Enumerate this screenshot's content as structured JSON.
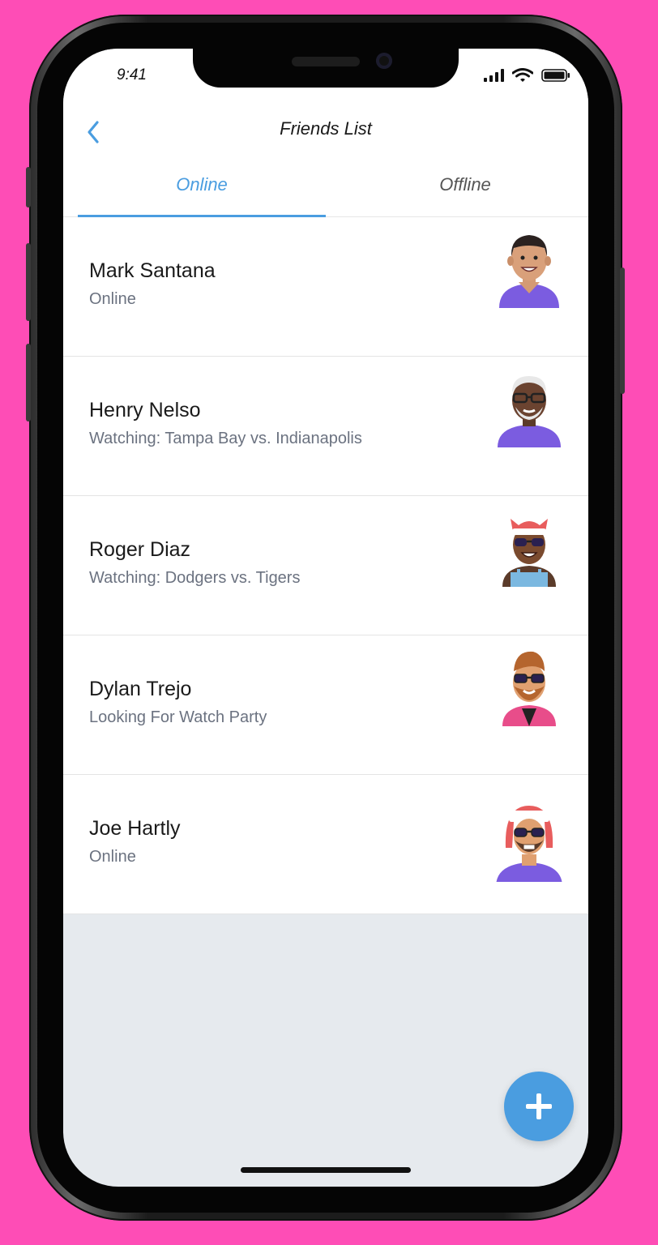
{
  "status_bar": {
    "time": "9:41"
  },
  "nav": {
    "title": "Friends List",
    "back_icon": "chevron-left-icon"
  },
  "tabs": [
    {
      "label": "Online",
      "active": true
    },
    {
      "label": "Offline",
      "active": false
    }
  ],
  "friends": [
    {
      "name": "Mark Santana",
      "status": "Online"
    },
    {
      "name": "Henry Nelso",
      "status": "Watching: Tampa Bay vs. Indianapolis"
    },
    {
      "name": "Roger Diaz",
      "status": "Watching: Dodgers vs. Tigers"
    },
    {
      "name": "Dylan Trejo",
      "status": "Looking For Watch Party"
    },
    {
      "name": "Joe Hartly",
      "status": "Online"
    }
  ],
  "fab": {
    "icon": "plus-icon"
  },
  "colors": {
    "accent": "#4a9de0",
    "background": "#fe4db6",
    "empty_area": "#e6eaee"
  }
}
